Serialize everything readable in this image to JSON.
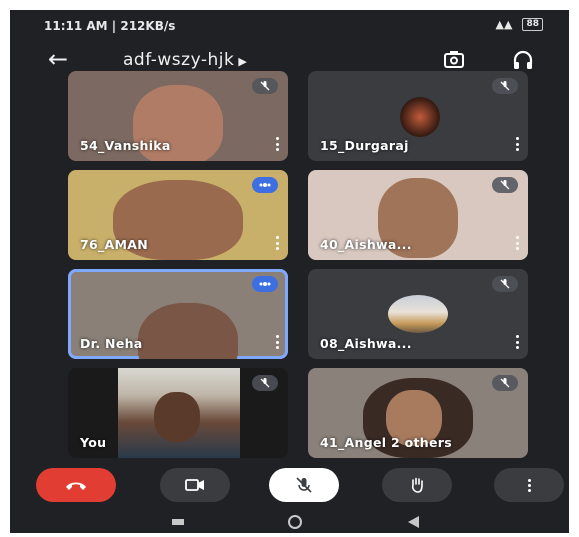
{
  "status_bar": {
    "time_text": "11:11 AM | 212KB/s",
    "battery_label": "88"
  },
  "meeting": {
    "code": "adf-wszy-hjk"
  },
  "tiles": [
    {
      "name": "54_Vanshika"
    },
    {
      "name": "15_Durgaraj"
    },
    {
      "name": "76_AMAN"
    },
    {
      "name": "40_Aishwa..."
    },
    {
      "name": "Dr. Neha"
    },
    {
      "name": "08_Aishwa..."
    },
    {
      "name": "You"
    },
    {
      "name": "41_Angel",
      "extra": "2 others"
    }
  ],
  "icons": {
    "back": "arrow-back-icon",
    "switch_camera": "switch-camera-icon",
    "audio": "headphones-icon",
    "muted": "mic-off-icon",
    "speaking": "speaking-indicator-icon",
    "more": "more-vert-icon",
    "end_call": "call-end-icon",
    "camera": "videocam-icon",
    "mic": "mic-off-icon",
    "raise_hand": "hand-raise-icon"
  },
  "colors": {
    "background": "#1f2124",
    "tile_bg": "#3a3c40",
    "end_call": "#e23d33",
    "active_outline": "#7fa8ff",
    "speaking_badge": "#3d6fe0"
  }
}
